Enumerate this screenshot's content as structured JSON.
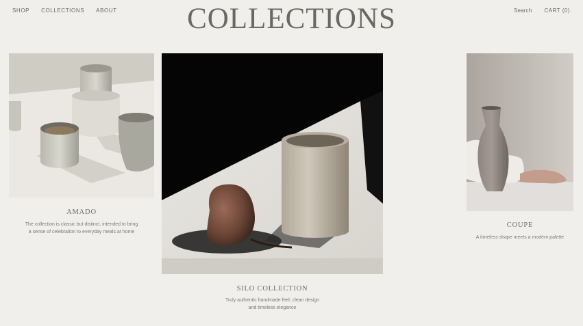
{
  "nav": {
    "left": [
      "SHOP",
      "COLLECTIONS",
      "ABOUT"
    ],
    "search": "Search",
    "cart": "CART (0)"
  },
  "page_title": "COLLECTIONS",
  "collections": [
    {
      "name": "AMADO",
      "description": "The collection is classic but distinct, intended to bring a sense of celebration to everyday meals at home"
    },
    {
      "name": "SILO  COLLECTION",
      "description": "Truly authentic handmade feel, clean design and timeless elegance"
    },
    {
      "name": "COUPE",
      "description": "A timeless shape meets a modern palette"
    }
  ]
}
